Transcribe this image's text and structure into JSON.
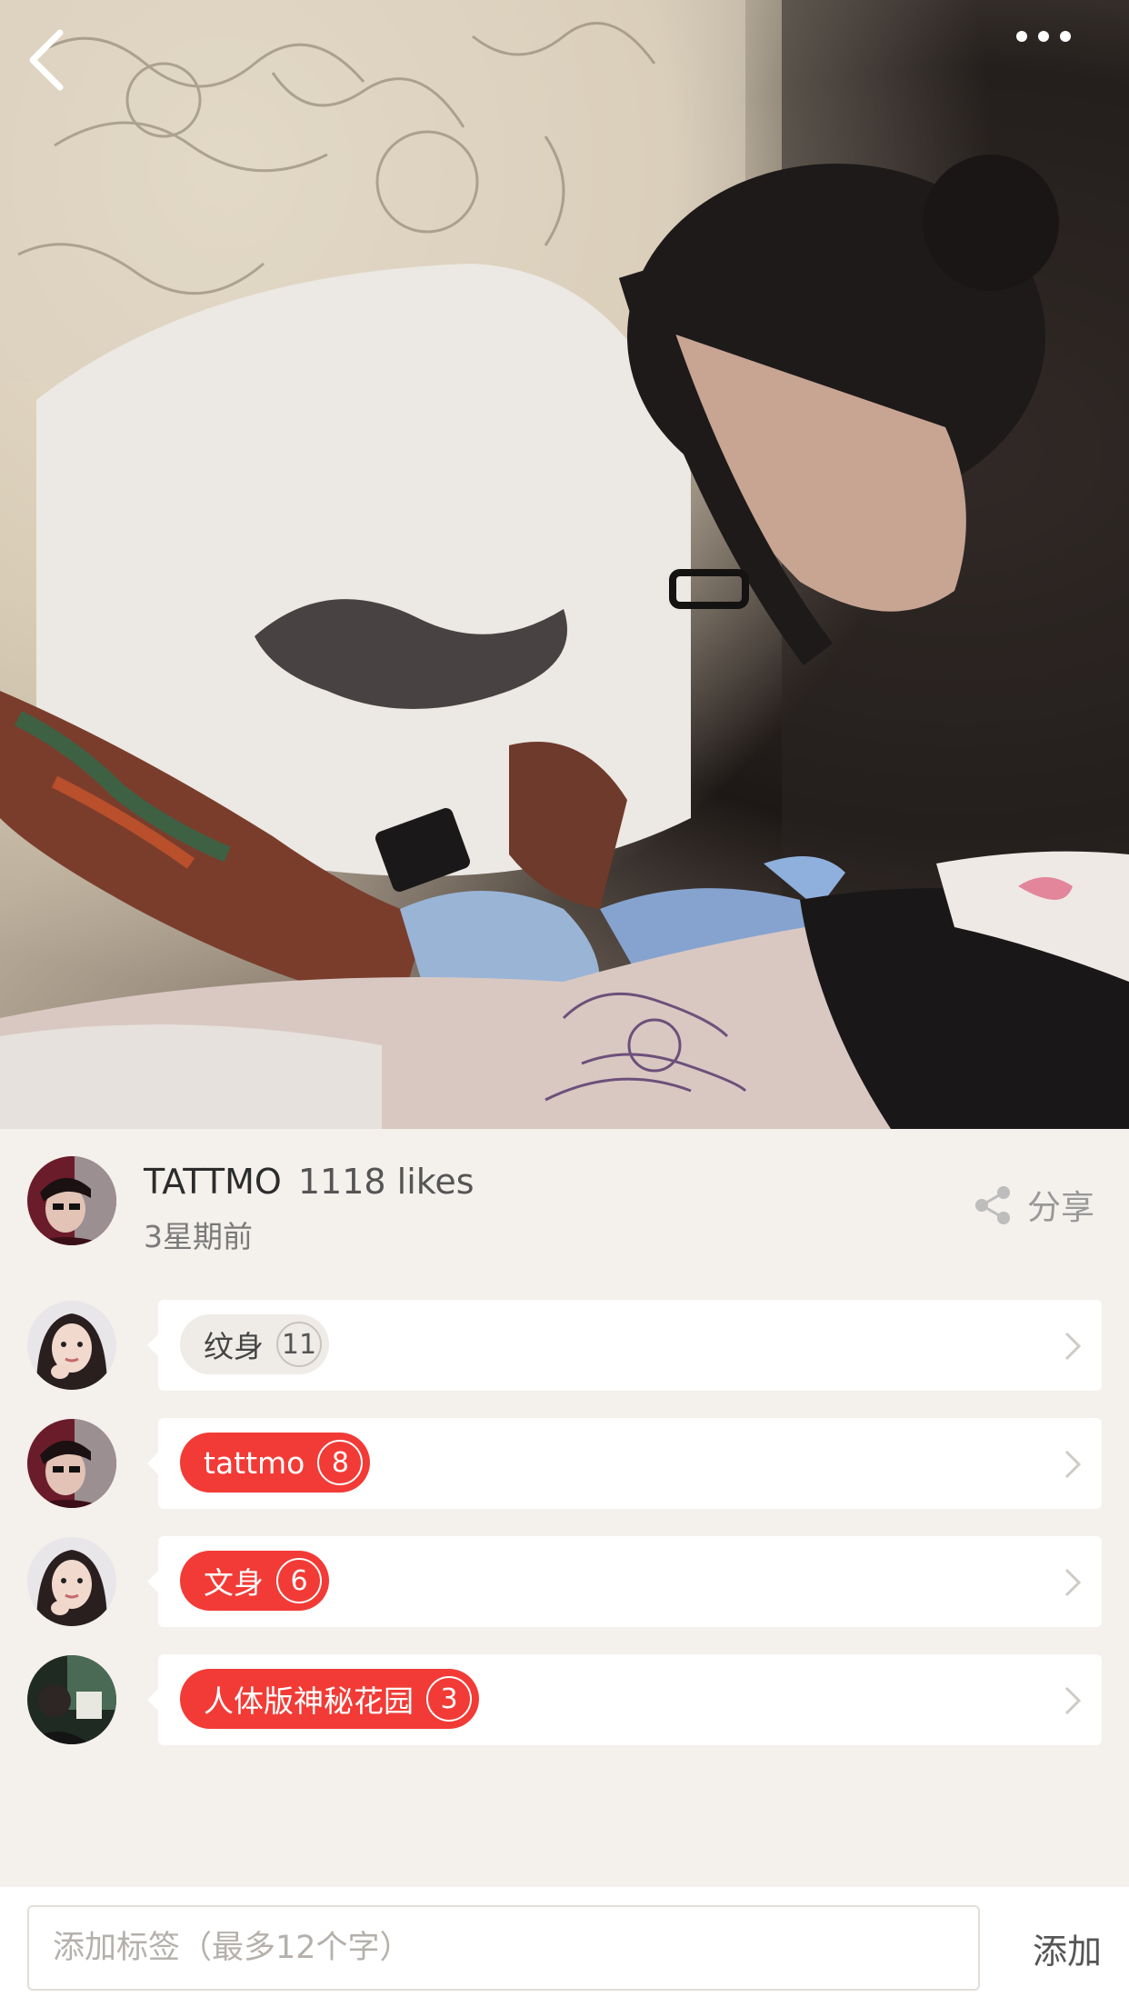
{
  "nav": {
    "back_icon": "chevron-left-icon",
    "more_icon": "more-horizontal-icon"
  },
  "post": {
    "author": "TATTMO",
    "likes": "1118 likes",
    "time": "3星期前",
    "share_label": "分享",
    "share_icon": "share-icon"
  },
  "tags": [
    {
      "label": "纹身",
      "count": "11",
      "style": "grey"
    },
    {
      "label": "tattmo",
      "count": "8",
      "style": "red"
    },
    {
      "label": "文身",
      "count": "6",
      "style": "red"
    },
    {
      "label": "人体版神秘花园",
      "count": "3",
      "style": "red"
    }
  ],
  "bottom": {
    "input_placeholder": "添加标签（最多12个字）",
    "add_label": "添加"
  },
  "colors": {
    "accent_red": "#f23b36",
    "background": "#f4f0ec"
  }
}
